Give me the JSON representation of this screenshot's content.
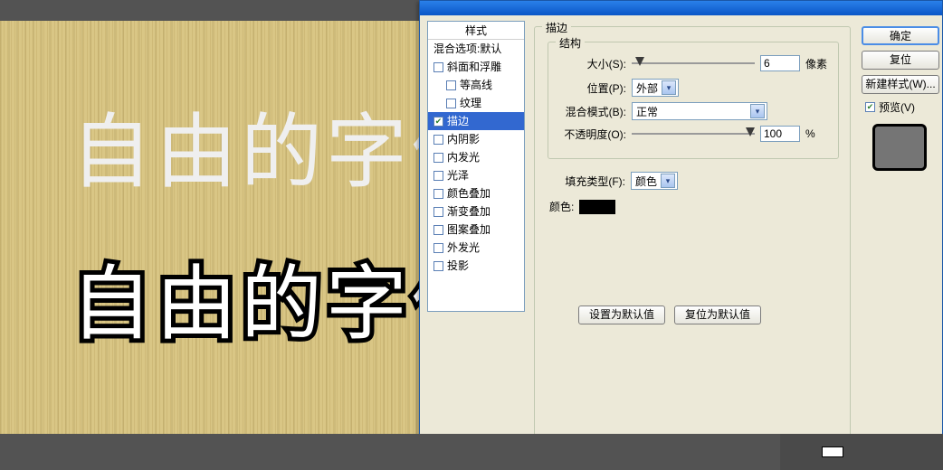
{
  "canvas": {
    "text1": "自由的字体",
    "text2": "自由的字体"
  },
  "styles_list": {
    "header": "样式",
    "blending": "混合选项:默认",
    "items": [
      {
        "label": "斜面和浮雕",
        "checked": false,
        "indent": false
      },
      {
        "label": "等高线",
        "checked": false,
        "indent": true
      },
      {
        "label": "纹理",
        "checked": false,
        "indent": true
      },
      {
        "label": "描边",
        "checked": true,
        "indent": false,
        "selected": true
      },
      {
        "label": "内阴影",
        "checked": false,
        "indent": false
      },
      {
        "label": "内发光",
        "checked": false,
        "indent": false
      },
      {
        "label": "光泽",
        "checked": false,
        "indent": false
      },
      {
        "label": "颜色叠加",
        "checked": false,
        "indent": false
      },
      {
        "label": "渐变叠加",
        "checked": false,
        "indent": false
      },
      {
        "label": "图案叠加",
        "checked": false,
        "indent": false
      },
      {
        "label": "外发光",
        "checked": false,
        "indent": false
      },
      {
        "label": "投影",
        "checked": false,
        "indent": false
      }
    ]
  },
  "stroke_panel": {
    "group_label": "描边",
    "structure_label": "结构",
    "size_label": "大小(S):",
    "size_value": "6",
    "size_unit": "像素",
    "position_label": "位置(P):",
    "position_value": "外部",
    "blend_mode_label": "混合模式(B):",
    "blend_mode_value": "正常",
    "opacity_label": "不透明度(O):",
    "opacity_value": "100",
    "opacity_unit": "%",
    "fill_type_label": "填充类型(F):",
    "fill_type_value": "颜色",
    "color_label": "颜色:",
    "color_value": "#000000",
    "set_default_btn": "设置为默认值",
    "reset_default_btn": "复位为默认值"
  },
  "right": {
    "ok": "确定",
    "cancel": "复位",
    "new_style": "新建样式(W)...",
    "preview_label": "预览(V)",
    "preview_checked": true
  }
}
